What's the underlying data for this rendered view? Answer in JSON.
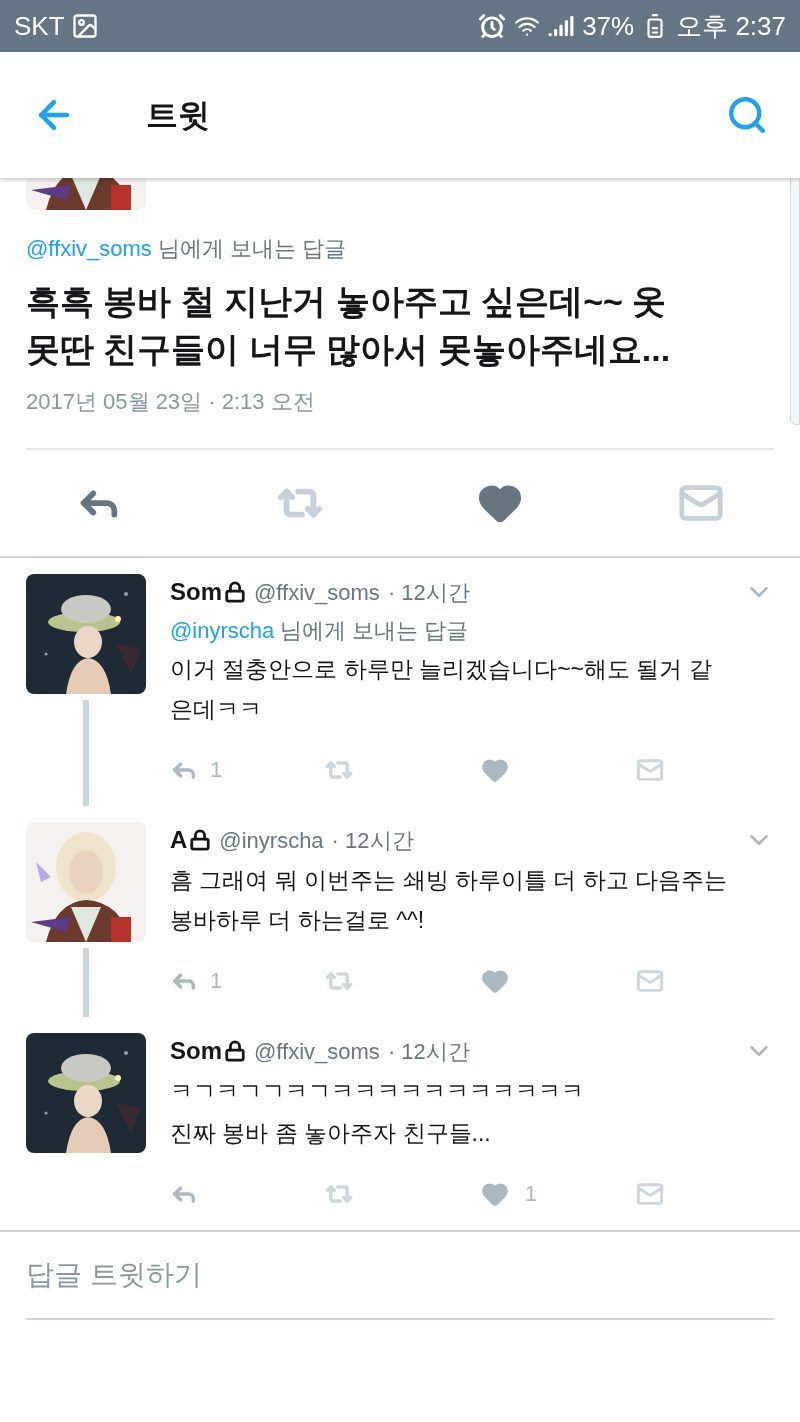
{
  "status_bar": {
    "carrier": "SKT",
    "battery": "37%",
    "time": "오후 2:37"
  },
  "header": {
    "title": "트윗"
  },
  "main_tweet": {
    "reply_to": {
      "handle": "@ffxiv_soms",
      "suffix": "님에게 보내는 답글"
    },
    "text": "흑흑 봉바 철 지난거 놓아주고 싶은데~~ 옷 못딴 친구들이 너무 많아서 못놓아주네요...",
    "timestamp": "2017년 05월 23일 · 2:13 오전"
  },
  "replies": [
    {
      "name": "Som",
      "handle": "@ffxiv_soms",
      "time": "· 12시간",
      "reply_to": {
        "handle": "@inyrscha",
        "suffix": "님에게 보내는 답글"
      },
      "lines": [
        "이거 절충안으로 하루만 늘리겠습니다~~해도 될거 같은데ㅋㅋ"
      ],
      "reply_count": "1"
    },
    {
      "name": "A",
      "handle": "@inyrscha",
      "time": "· 12시간",
      "lines": [
        "흠 그래여 뭐 이번주는 쇄빙 하루이틀 더 하고 다음주는 봉바하루 더 하는걸로 ^^!"
      ],
      "reply_count": "1"
    },
    {
      "name": "Som",
      "handle": "@ffxiv_soms",
      "time": "· 12시간",
      "lines": [
        "ㅋㄱㅋㄱㄱㅋㄱㅋㅋㅋㅋㅋㅋㅋㅋㅋㅋㅋ",
        "진짜 봉바 좀 놓아주자 친구들..."
      ],
      "like_count": "1"
    }
  ],
  "compose": {
    "placeholder": "답글 트윗하기"
  }
}
